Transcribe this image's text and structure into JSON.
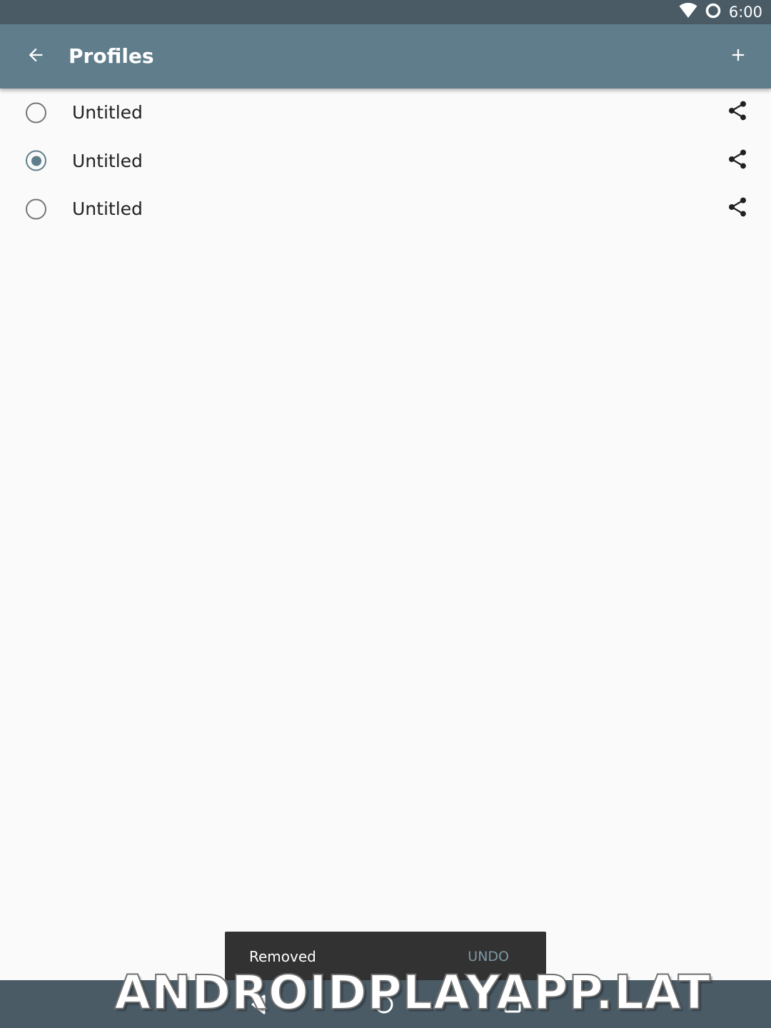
{
  "status_bar": {
    "time": "6:00",
    "icons": [
      "wifi-icon",
      "sync-icon"
    ]
  },
  "app_bar": {
    "title": "Profiles",
    "back_icon": "arrow-back-icon",
    "add_icon": "plus-icon"
  },
  "profiles": [
    {
      "label": "Untitled",
      "selected": false,
      "action_icon": "share-icon"
    },
    {
      "label": "Untitled",
      "selected": true,
      "action_icon": "share-icon"
    },
    {
      "label": "Untitled",
      "selected": false,
      "action_icon": "share-icon"
    }
  ],
  "snackbar": {
    "message": "Removed",
    "action": "UNDO"
  },
  "nav_bar": {
    "icons": [
      "back-triangle-icon",
      "home-circle-icon",
      "recents-square-icon"
    ]
  },
  "watermark": "ANDROIDPLAYAPP.LAT",
  "colors": {
    "primary": "#607d8b",
    "status_bar": "#4a5b66",
    "background": "#fafafa",
    "snackbar": "#323232",
    "snackbar_action": "#7d98a5"
  }
}
